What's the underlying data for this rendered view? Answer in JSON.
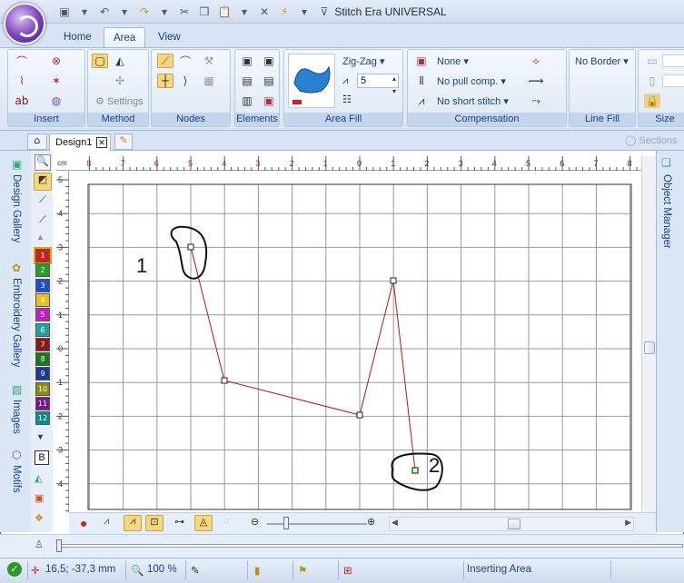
{
  "window": {
    "title": "Stitch Era UNIVERSAL"
  },
  "ribbon_tabs": [
    "Home",
    "Area",
    "View"
  ],
  "active_tab": "Area",
  "groups": {
    "insert": "Insert",
    "method": "Method",
    "method_settings": "Settings",
    "nodes": "Nodes",
    "elements": "Elements",
    "area_fill": "Area Fill",
    "compensation": "Compensation",
    "line_fill": "Line Fill",
    "size": "Size"
  },
  "area_fill": {
    "pattern": "Zig-Zag",
    "density": "5"
  },
  "compensation": {
    "none": "None",
    "pull": "No pull comp.",
    "short": "No short stitch"
  },
  "line_fill": {
    "border": "No Border"
  },
  "doc": {
    "tab": "Design1",
    "sections": "Sections"
  },
  "side_panels": {
    "design_gallery": "Design Gallery",
    "embroidery_gallery": "Embroidery Gallery",
    "images": "Images",
    "motifs": "Motifs",
    "object_manager": "Object Manager"
  },
  "ruler": {
    "unit": "cm",
    "h_ticks": [
      "8",
      "7",
      "6",
      "5",
      "4",
      "3",
      "2",
      "1",
      "0",
      "1",
      "2",
      "3",
      "4",
      "5",
      "6",
      "7",
      "8"
    ],
    "v_ticks": [
      "5",
      "4",
      "3",
      "2",
      "1",
      "0",
      "1",
      "2",
      "3",
      "4",
      "5"
    ]
  },
  "palette": [
    "1",
    "2",
    "3",
    "4",
    "5",
    "6",
    "7",
    "8",
    "9",
    "10",
    "11",
    "12"
  ],
  "palette_colors": [
    "#cc2020",
    "#2a9a2a",
    "#2050c8",
    "#e8c020",
    "#c020c0",
    "#20a0a0",
    "#8a1a1a",
    "#1a7a1a",
    "#1a3a9a",
    "#8a8a10",
    "#7a1a8a",
    "#108a8a"
  ],
  "palette_b": "B",
  "annotations": {
    "label1": "1",
    "label2": "2"
  },
  "path_color": "#b01818",
  "status": {
    "coords": "16,5; -37,3 mm",
    "zoom": "100 %",
    "mode": "Inserting Area"
  }
}
